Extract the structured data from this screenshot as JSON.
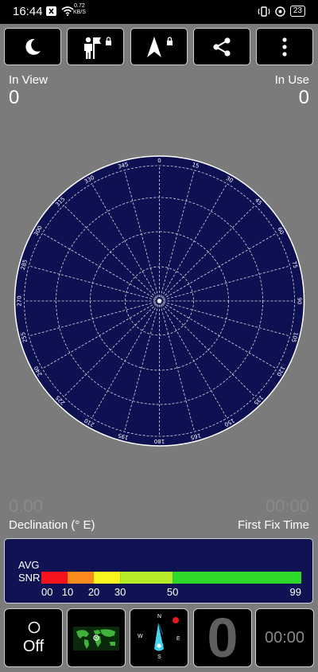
{
  "status_bar": {
    "time": "16:44",
    "net_speed_value": "0.72",
    "net_speed_unit": "KB/S",
    "battery": "23",
    "icons": [
      "notification-x-icon",
      "wifi-icon",
      "vibrate-icon",
      "alarm-icon",
      "battery-icon"
    ]
  },
  "toolbar": {
    "buttons": [
      {
        "name": "night-mode",
        "icon": "moon-icon"
      },
      {
        "name": "man-with-flag",
        "icon": "person-flag-lock-icon"
      },
      {
        "name": "navigation",
        "icon": "navigation-arrow-lock-icon"
      },
      {
        "name": "share",
        "icon": "share-icon"
      },
      {
        "name": "more",
        "icon": "more-vert-icon"
      }
    ]
  },
  "satellites": {
    "in_view_label": "In View",
    "in_view_value": "0",
    "in_use_label": "In Use",
    "in_use_value": "0"
  },
  "radar": {
    "background": "#0d1152",
    "bearings": [
      "0",
      "15",
      "30",
      "45",
      "60",
      "75",
      "90",
      "105",
      "120",
      "135",
      "150",
      "165",
      "180",
      "195",
      "210",
      "225",
      "240",
      "255",
      "270",
      "285",
      "300",
      "315",
      "330",
      "345"
    ]
  },
  "declination": {
    "value": "0.00",
    "label": "Declination (° E)"
  },
  "first_fix": {
    "value": "00:00",
    "label": "First Fix Time"
  },
  "snr": {
    "avg_label": "AVG",
    "snr_label": "SNR",
    "segments": [
      {
        "color": "#f5141e",
        "from": 0,
        "to": 10
      },
      {
        "color": "#fb8c1c",
        "from": 10,
        "to": 20
      },
      {
        "color": "#f7f51c",
        "from": 20,
        "to": 30
      },
      {
        "color": "#b6ec27",
        "from": 30,
        "to": 50
      },
      {
        "color": "#2fd92a",
        "from": 50,
        "to": 99
      }
    ],
    "ticks": [
      "00",
      "10",
      "20",
      "30",
      "50",
      "99"
    ]
  },
  "bottom": {
    "record_label": "Off",
    "compass_n": "N",
    "compass_s": "S",
    "compass_w": "W",
    "compass_e": "E",
    "big_zero": "0",
    "timer": "00:00"
  }
}
